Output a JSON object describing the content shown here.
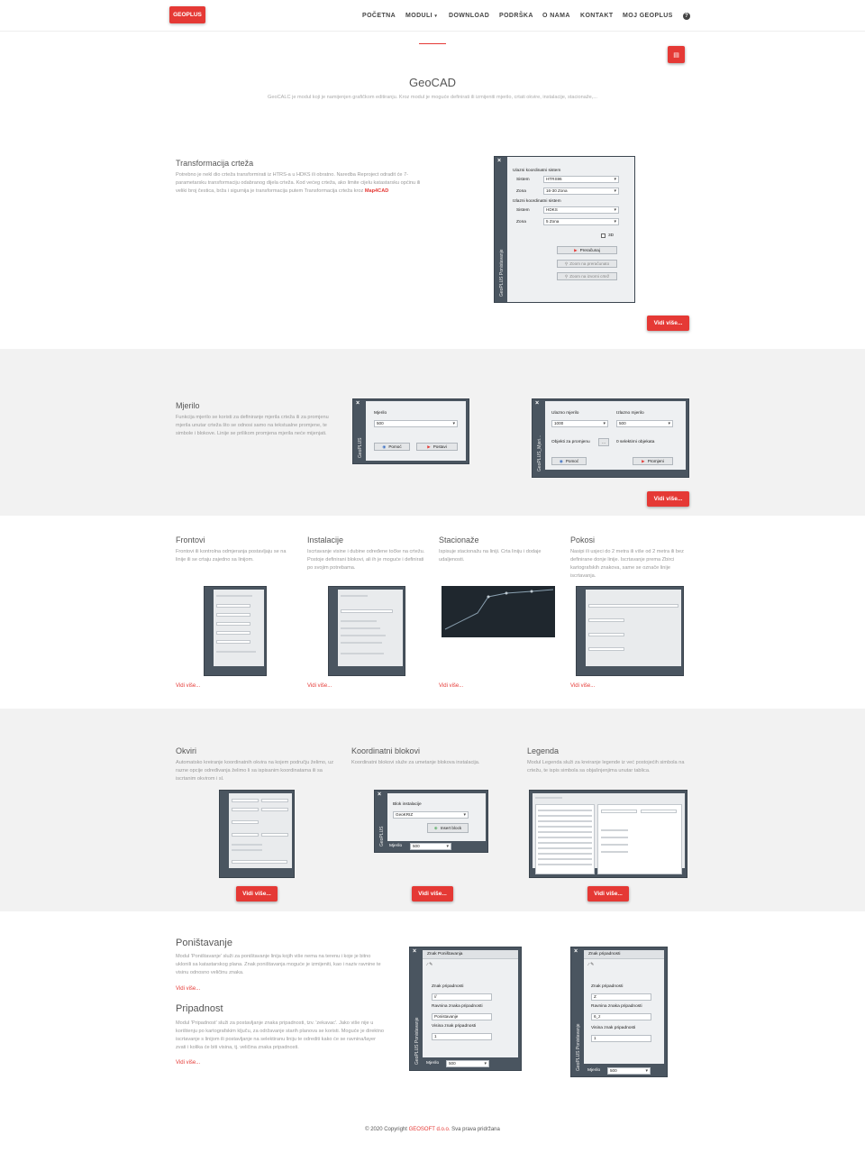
{
  "header": {
    "logo": "GEOPLUS",
    "nav": [
      "POČETNA",
      "MODULI",
      "DOWNLOAD",
      "PODRŠKA",
      "O NAMA",
      "KONTAKT",
      "MOJ GEOPLUS"
    ],
    "help_icon": "question-circle-icon"
  },
  "hero": {
    "title": "GeoCAD",
    "subtitle": "GeoCALC je modul koji je namijenjen grafičkom editiranju. Kroz modul je moguće definirati ili izmijeniti mjerilo, crtati okvire, instalacije, stacionaže,..."
  },
  "transformacija": {
    "title": "Transformacija crteža",
    "text": "Potrebno je nekl dio crteža transformirati iz HTRS-a u HDKS ili obratno. Naredba Reproject odradit će 7-parametarsku transformaciju odabranog dijela crteža. Kod većeg crteža, ako limite cijelu katastarsku općinu ili veliki broj čestica, brža i sigurnija je transformacija putem Transformacija crteža kroz",
    "link": "Map4CAD",
    "more": "Vidi više...",
    "dialog": {
      "side": "GeoPLUS Ponistavanje",
      "in_title": "Ulazni koordinatni sistem",
      "out_title": "Izlazni koordinatni sistem",
      "sistem_label": "Sistem",
      "zona_label": "Zona",
      "in_sistem": "HTRS96",
      "in_zona": "16-30 Zona",
      "out_sistem": "HDKS",
      "out_zona": "5 Zona",
      "check_3d": "3D",
      "btn_calc": "Preračunaj",
      "btn_zoom1": "Zoom na preračunato",
      "btn_zoom2": "Zoom na izvorni crtež"
    }
  },
  "mjerilo": {
    "title": "Mjerilo",
    "text": "Funkcija mjerilo se koristi za definiranje mjerila crteža ili za promjenu mjerila unutar crteža što se odnosi samo na tekstualne promjene, te simbole i blokove. Linije se prilikom promjena mjerila neće mijenjati.",
    "more": "Vidi više...",
    "dialog1": {
      "side": "GeoPLUS",
      "label": "Mjerilo",
      "value": "500",
      "help": "Pomoć",
      "set": "Postavi"
    },
    "dialog2": {
      "side": "GeoPLUS_Mjeri...",
      "in_label": "Ulazno mjerilo",
      "in_value": "1000",
      "out_label": "Izlazno mjerilo",
      "out_value": "500",
      "objects_label": "Objekti za promjenu",
      "dots": "...",
      "selected": "0 selektirni objekata",
      "help": "Pomoć",
      "change": "Promjeni"
    }
  },
  "four": [
    {
      "title": "Frontovi",
      "text": "Frontovi ili kontrolna odmjeranja postavljaju se na linije ili se crtaju zajedno sa linijom.",
      "more": "Vidi više..."
    },
    {
      "title": "Instalacije",
      "text": "Iscrtavanje visine i dubine određene točke na crtežu. Postoje definirani blokovi, ali ih je moguće i definirati po svojim potrebama.",
      "more": "Vidi više..."
    },
    {
      "title": "Stacionaže",
      "text": "Ispisuje stacionažu na liniji. Crta liniju i dodaje udaljenosti.",
      "more": "Vidi više..."
    },
    {
      "title": "Pokosi",
      "text": "Nasipi ili usjeci do 2 metra ili više od 2 metra ili bez definirane donje linije. Iscrtavanje prema Zbirci kartografskih znakova, same se označe linije iscrtavanja.",
      "more": "Vidi više..."
    }
  ],
  "three": [
    {
      "title": "Okviri",
      "text": "Automatsko kreiranje koordinatnih okvira na kojem području želimo, uz razne opcije određivanja želimo li sa ispisanim koordinatama ili sa iscrtanim okvirom i sl.",
      "more": "Vidi više..."
    },
    {
      "title": "Koordinatni blokovi",
      "text": "Koordinatni blokovi služe za umetanje blokova instalacija.",
      "more": "Vidi više...",
      "dlg": {
        "label": "Blok instalacije",
        "value": "GeoKRIZ",
        "button": "Insert block",
        "scale_label": "Mjerilo",
        "scale_value": "500"
      }
    },
    {
      "title": "Legenda",
      "text": "Modul Legenda služi za kreiranje legende iz već postojećih simbola na crtežu, te ispis simbola sa objašnjenjima unutar tablica.",
      "more": "Vidi više..."
    }
  ],
  "ponistavanje": {
    "title": "Poništavanje",
    "text": "Modul 'Poništavanje' služi za poništavanje linija kojih više nema na terenu i koje je bitno uklonili sa katastarskog plana. Znak poništavanja moguće je izmijeniti, kao i naziv ravnine te visinu odnosno veličinu znaka.",
    "more": "Vidi više...",
    "dialog": {
      "title": "Znak Poništavanja",
      "side": "GeoPLUS Ponistavanje",
      "l1": "Znak pripadnosti",
      "v1": "//",
      "l2": "Ravnina znaka pripadnosti",
      "v2": "Ponistavanje",
      "l3": "Visina znak pripadnosti",
      "v3": "1",
      "scale_label": "Mjerilo",
      "scale_value": "500"
    }
  },
  "pripadnost": {
    "title": "Pripadnost",
    "text": "Modul 'Pripadnost' služi za postavljanje znaka pripadnosti, tzv. 'zekavac'. Jako više nije u korištenju po kartografskim ključu, za održavanje starih planova se koristi. Moguće je direktno iscrtavanje s linijom ili postavljanje na selektiranu liniju te odrediti kako će se ravnina/layer zvati i kolika će biti visina, tj. veličina znaka pripadnosti.",
    "more": "Vidi više...",
    "dialog": {
      "title": "Znak pripadnosti",
      "side": "GeoPLUS Ponistavanje",
      "l1": "Znak pripadnosti",
      "v1": "Z",
      "l2": "Ravnina znaka pripadnosti",
      "v2": "6_z",
      "l3": "Visina znak pripadnosti",
      "v3": "1",
      "scale_label": "Mjerilo",
      "scale_value": "500"
    }
  },
  "footer": {
    "prefix": "© 2020 Copyright",
    "company": "GEOSOFT d.o.o.",
    "suffix": "Sva prava pridržana"
  }
}
